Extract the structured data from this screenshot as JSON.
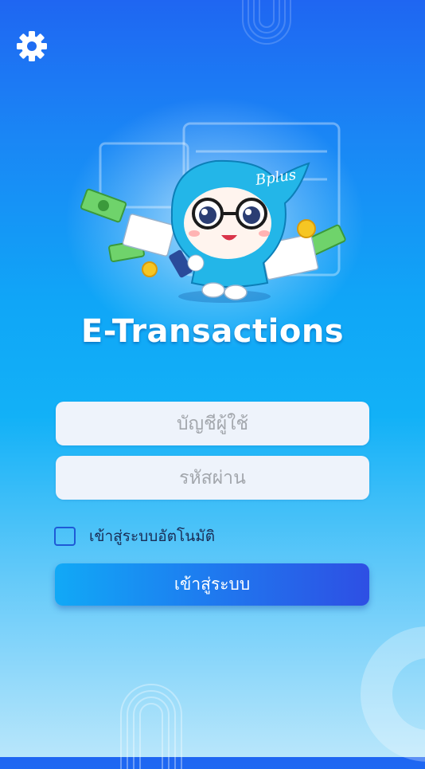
{
  "header": {
    "settings_icon": "gear-icon"
  },
  "hero": {
    "mascot_badge": "Bplus",
    "title": "E-Transactions"
  },
  "form": {
    "username_placeholder": "บัญชีผู้ใช้",
    "password_placeholder": "รหัสผ่าน",
    "remember_label": "เข้าสู่ระบบอัตโนมัติ",
    "remember_checked": false,
    "login_label": "เข้าสู่ระบบ"
  },
  "colors": {
    "background_top": "#1f66f2",
    "background_bottom": "#b8e6fb",
    "button_start": "#11a9f6",
    "button_end": "#2e4fe4",
    "field_background": "#eef3fb",
    "checkbox_border": "#1e5ad6"
  }
}
